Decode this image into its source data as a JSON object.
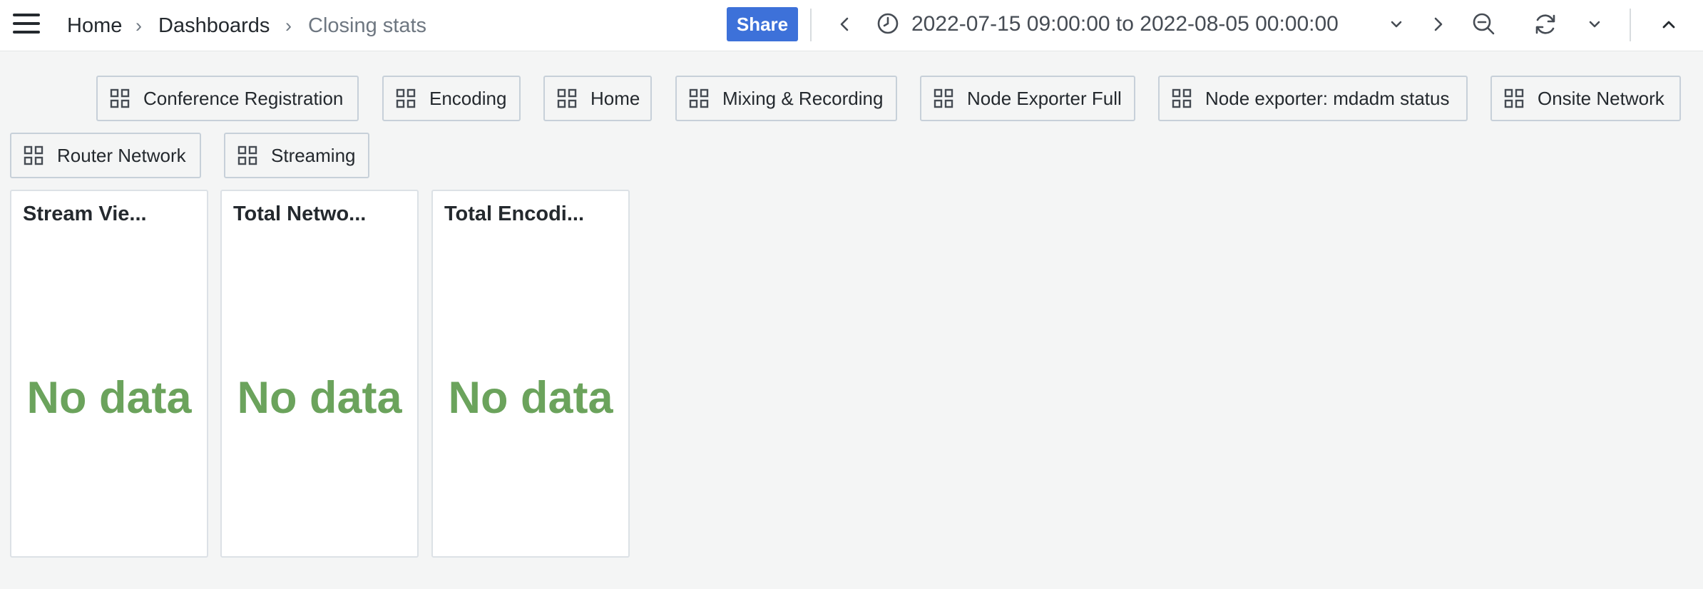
{
  "breadcrumb": {
    "home": "Home",
    "separator": "›",
    "dashboards": "Dashboards",
    "current": "Closing stats"
  },
  "toolbar": {
    "share_label": "Share",
    "time_range": {
      "from": "2022-07-15 09:00:00",
      "to_word": "to",
      "to": "2022-08-05 00:00:00"
    }
  },
  "dashboard_links": [
    {
      "label": "Conference Registration"
    },
    {
      "label": "Encoding"
    },
    {
      "label": "Home"
    },
    {
      "label": "Mixing & Recording"
    },
    {
      "label": "Node Exporter Full"
    },
    {
      "label": "Node exporter: mdadm status"
    },
    {
      "label": "Onsite Network"
    },
    {
      "label": "Router Network"
    },
    {
      "label": "Streaming"
    }
  ],
  "panels": [
    {
      "title": "Stream Vie...",
      "value": "No data"
    },
    {
      "title": "Total Netwo...",
      "value": "No data"
    },
    {
      "title": "Total Encodi...",
      "value": "No data"
    }
  ],
  "colors": {
    "accent": "#3d71d9",
    "no_data": "#6ba35c",
    "background": "#f4f5f5",
    "panel_border": "#dce1e6"
  },
  "icons": {
    "menu": "hamburger-icon",
    "time_back": "chevron-left-icon",
    "clock": "clock-icon",
    "time_dropdown": "chevron-down-icon",
    "time_forward": "chevron-right-icon",
    "zoom_out": "zoom-out-icon",
    "refresh": "refresh-icon",
    "refresh_dropdown": "chevron-down-icon",
    "collapse": "chevron-up-icon",
    "dashboard_link": "apps-grid-icon"
  }
}
